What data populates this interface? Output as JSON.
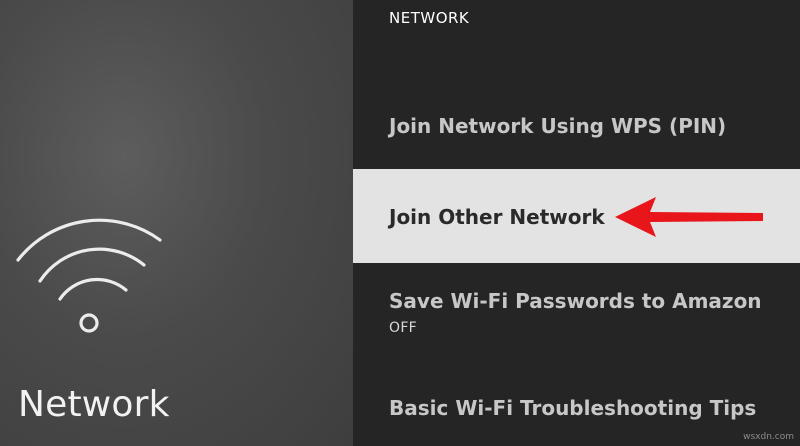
{
  "sidebar": {
    "icon": "wifi-icon",
    "title": "Network"
  },
  "panel": {
    "header": "NETWORK",
    "items": [
      {
        "label": "Join Network Using WPS (PIN)",
        "selected": false
      },
      {
        "label": "Join Other Network",
        "selected": true
      },
      {
        "label": "Save Wi-Fi Passwords to Amazon",
        "subtitle": "OFF",
        "selected": false
      },
      {
        "label": "Basic Wi-Fi Troubleshooting Tips",
        "selected": false
      }
    ]
  },
  "annotation": {
    "icon": "red-arrow-icon",
    "color": "#e8151b"
  },
  "watermark": "wsxdn.com",
  "colors": {
    "background_left": "#4a4a4a",
    "background_right": "#252525",
    "selected_row": "#e3e3e3",
    "text_light": "#c7c7c7",
    "text_dark": "#2a2a2a"
  }
}
